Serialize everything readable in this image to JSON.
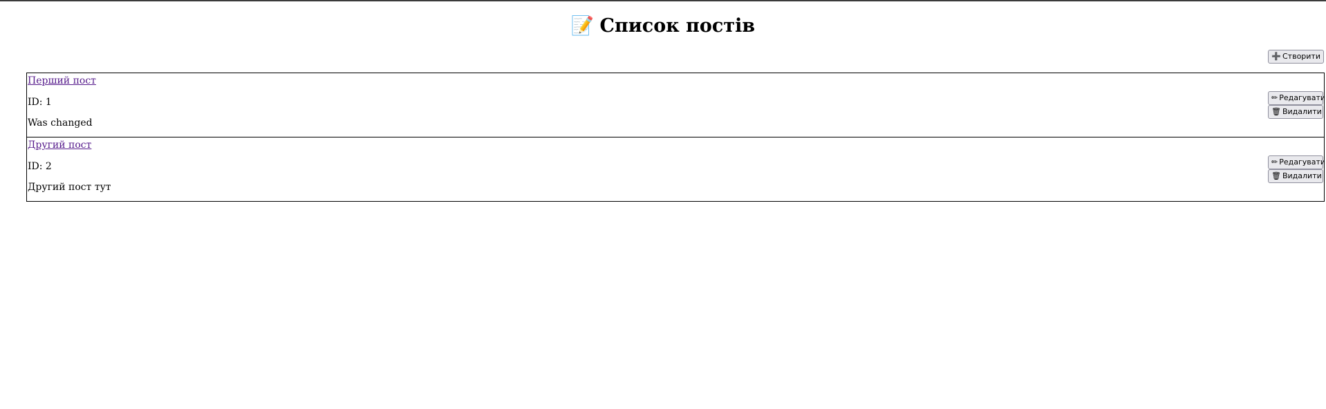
{
  "header": {
    "title_icon": "📝",
    "title": "Список постів"
  },
  "toolbar": {
    "create_icon": "➕",
    "create_label": "Створити"
  },
  "posts": [
    {
      "title": "Перший пост",
      "id_text": "ID: 1",
      "body": "Was changed",
      "edit_icon": "✏",
      "edit_label": "Редагувати",
      "delete_icon": "🗑",
      "delete_label": "Видалити"
    },
    {
      "title": "Другий пост",
      "id_text": "ID: 2",
      "body": "Другий пост тут",
      "edit_icon": "✏",
      "edit_label": "Редагувати",
      "delete_icon": "🗑",
      "delete_label": "Видалити"
    }
  ],
  "colors": {
    "link_visited": "#551a8b",
    "button_bg": "#e9e9ed",
    "button_border": "#8f8f9d"
  }
}
